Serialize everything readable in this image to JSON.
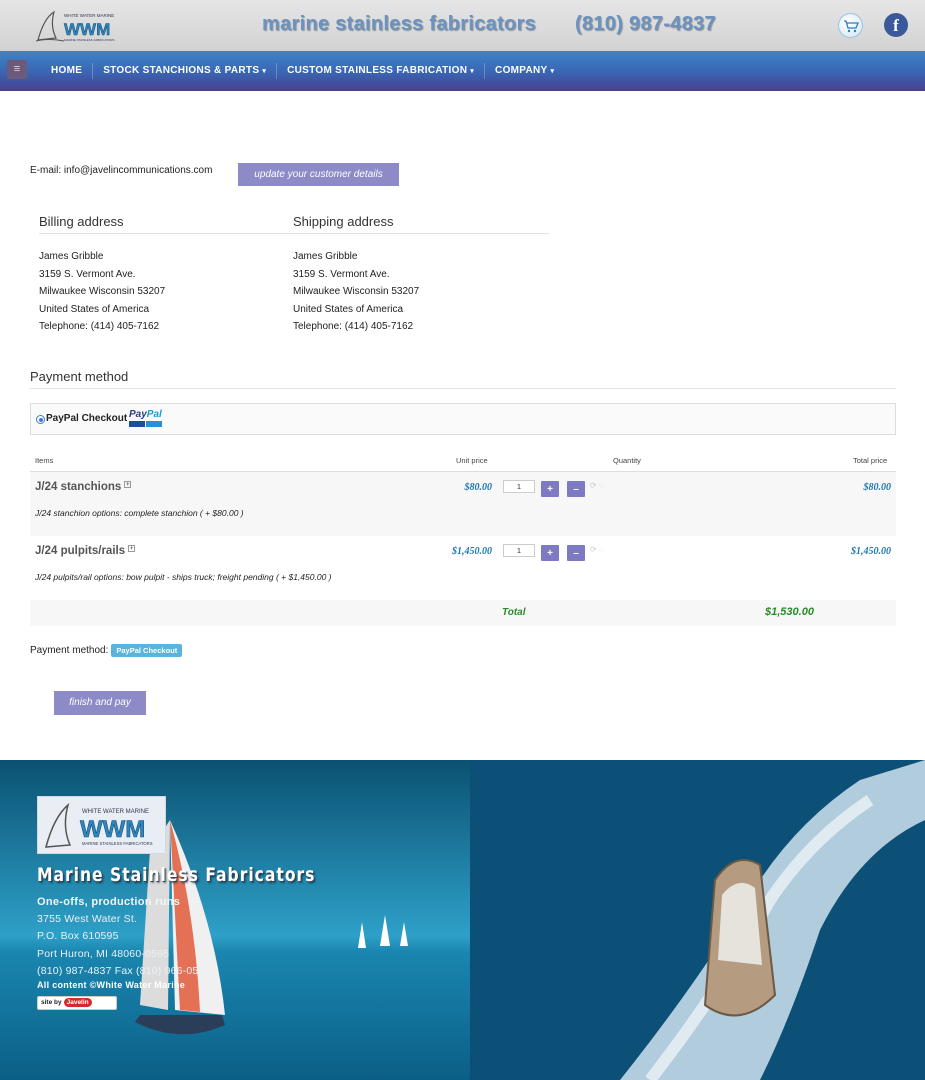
{
  "header": {
    "logo_text": "WHITE WATER MARINE",
    "logo_letters": "WWM",
    "logo_sub": "MARINE STAINLESS FABRICATORS",
    "tagline": "marine stainless fabricators",
    "phone": "(810) 987-4837",
    "cart_icon": "cart-icon",
    "facebook_icon": "facebook-icon",
    "facebook_glyph": "f"
  },
  "nav": {
    "menu_icon": "≡",
    "items": [
      {
        "label": "HOME",
        "caret": ""
      },
      {
        "label": "STOCK STANCHIONS & PARTS",
        "caret": "▾"
      },
      {
        "label": "CUSTOM STAINLESS FABRICATION",
        "caret": "▾"
      },
      {
        "label": "COMPANY",
        "caret": "▾"
      }
    ]
  },
  "customer": {
    "email_label": "E-mail: info@javelincommunications.com",
    "update_button": "update your customer details"
  },
  "billing": {
    "heading": "Billing address",
    "lines": [
      "James Gribble",
      "3159 S. Vermont Ave.",
      "Milwaukee Wisconsin 53207",
      "United States of America",
      "Telephone: (414) 405-7162"
    ]
  },
  "shipping": {
    "heading": "Shipping address",
    "lines": [
      "James Gribble",
      "3159 S. Vermont Ave.",
      "Milwaukee Wisconsin 53207",
      "United States of America",
      "Telephone: (414) 405-7162"
    ]
  },
  "payment": {
    "heading": "Payment method",
    "option_label": "PayPal Checkout",
    "paypal_word_1": "Pay",
    "paypal_word_2": "Pal"
  },
  "table": {
    "headers": {
      "items": "Items",
      "unit_price": "Unit price",
      "quantity": "Quantity",
      "total_price": "Total price"
    },
    "rows": [
      {
        "name": "J/24 stanchions",
        "unit_price": "$80.00",
        "qty": "1",
        "total": "$80.00",
        "options": "J/24 stanchion options: complete stanchion ( + $80.00 )"
      },
      {
        "name": "J/24 pulpits/rails",
        "unit_price": "$1,450.00",
        "qty": "1",
        "total": "$1,450.00",
        "options": "J/24 pulpits/rail options: bow pulpit - ships truck; freight pending ( + $1,450.00 )"
      }
    ],
    "plus": "+",
    "minus": "–",
    "info_glyph": "+",
    "refresh_glyph": "⟳ ◌",
    "total_label": "Total",
    "total_value": "$1,530.00"
  },
  "summary": {
    "label": "Payment method:",
    "badge": "PayPal Checkout",
    "finish_button": "finish and pay"
  },
  "footer": {
    "logo_text": "WHITE WATER MARINE",
    "logo_letters": "WWM",
    "logo_sub": "MARINE STAINLESS FABRICATORS",
    "title": "Marine Stainless Fabricators",
    "subtitle": "One-offs, production runs",
    "address_lines": [
      "3755 West Water St.",
      "P.O. Box 610595",
      "Port Huron, MI 48060-0595",
      "(810) 987-4837 Fax (810) 966-0597"
    ],
    "copyright": "All content ©White Water Marine",
    "site_by": "site by",
    "javelin": "Javelin"
  },
  "colors": {
    "accent_button": "#8d8ac8",
    "price_blue": "#1f7ab0",
    "total_green": "#2a8a2a",
    "nav_top": "#3d84c9",
    "nav_bottom": "#4a3f8f",
    "badge": "#5ab4dc"
  }
}
